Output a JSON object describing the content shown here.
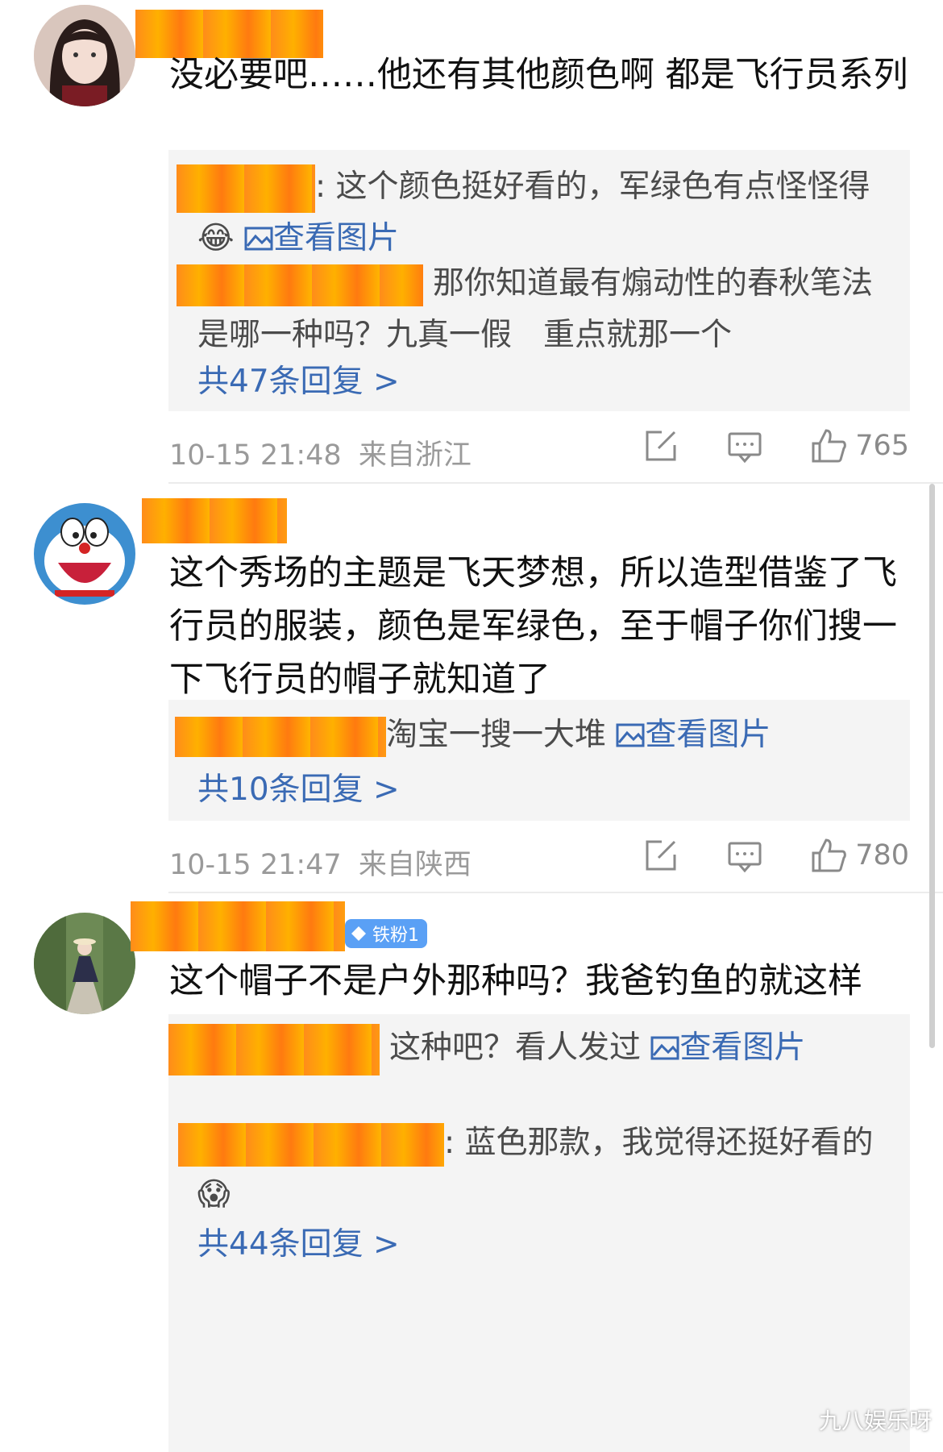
{
  "comments": [
    {
      "text": "没必要吧……他还有其他颜色啊 都是飞行员系列",
      "replies": [
        {
          "text": ": 这个颜色挺好看的，军绿色有点怪怪得",
          "link": "查看图片",
          "emoji": "😂"
        },
        {
          "text": "那你知道最有煽动性的春秋笔法是哪一种吗？九真一假　重点就那一个"
        }
      ],
      "more": "共47条回复 >",
      "time": "10-15 21:48",
      "location": "来自浙江",
      "likes": "765"
    },
    {
      "text": "这个秀场的主题是飞天梦想，所以造型借鉴了飞行员的服装，颜色是军绿色，至于帽子你们搜一下飞行员的帽子就知道了",
      "replies": [
        {
          "text": "淘宝一搜一大堆",
          "link": "查看图片"
        }
      ],
      "more": "共10条回复 >",
      "time": "10-15 21:47",
      "location": "来自陕西",
      "likes": "780"
    },
    {
      "badge": "铁粉1",
      "text": "这个帽子不是户外那种吗？我爸钓鱼的就这样",
      "replies": [
        {
          "text": "这种吧？看人发过",
          "link": "查看图片"
        },
        {
          "text": ": 蓝色那款，我觉得还挺好看的",
          "emoji": "😱"
        }
      ],
      "more": "共44条回复 >"
    }
  ],
  "watermark": "九八娱乐呀",
  "colors": {
    "link": "#3a6ab4",
    "reply_bg": "#f4f4f4",
    "mask": "#ff9a10",
    "badge": "#5aa0f5"
  }
}
